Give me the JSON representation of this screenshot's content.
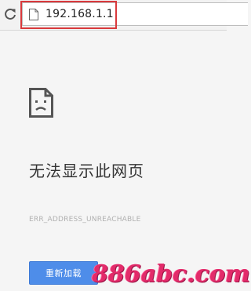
{
  "toolbar": {
    "reload_icon": "reload-icon",
    "page_icon": "blank-page-icon",
    "url": "192.168.1.1",
    "highlight_color": "#d9393c"
  },
  "error_page": {
    "icon": "sad-page-icon",
    "headline": "无法显示此网页",
    "error_code": "ERR_ADDRESS_UNREACHABLE",
    "reload_button_label": "重新加载",
    "button_color": "#4e8de9"
  },
  "watermark": {
    "text": "886abc.com",
    "color": "#e32b6a"
  }
}
